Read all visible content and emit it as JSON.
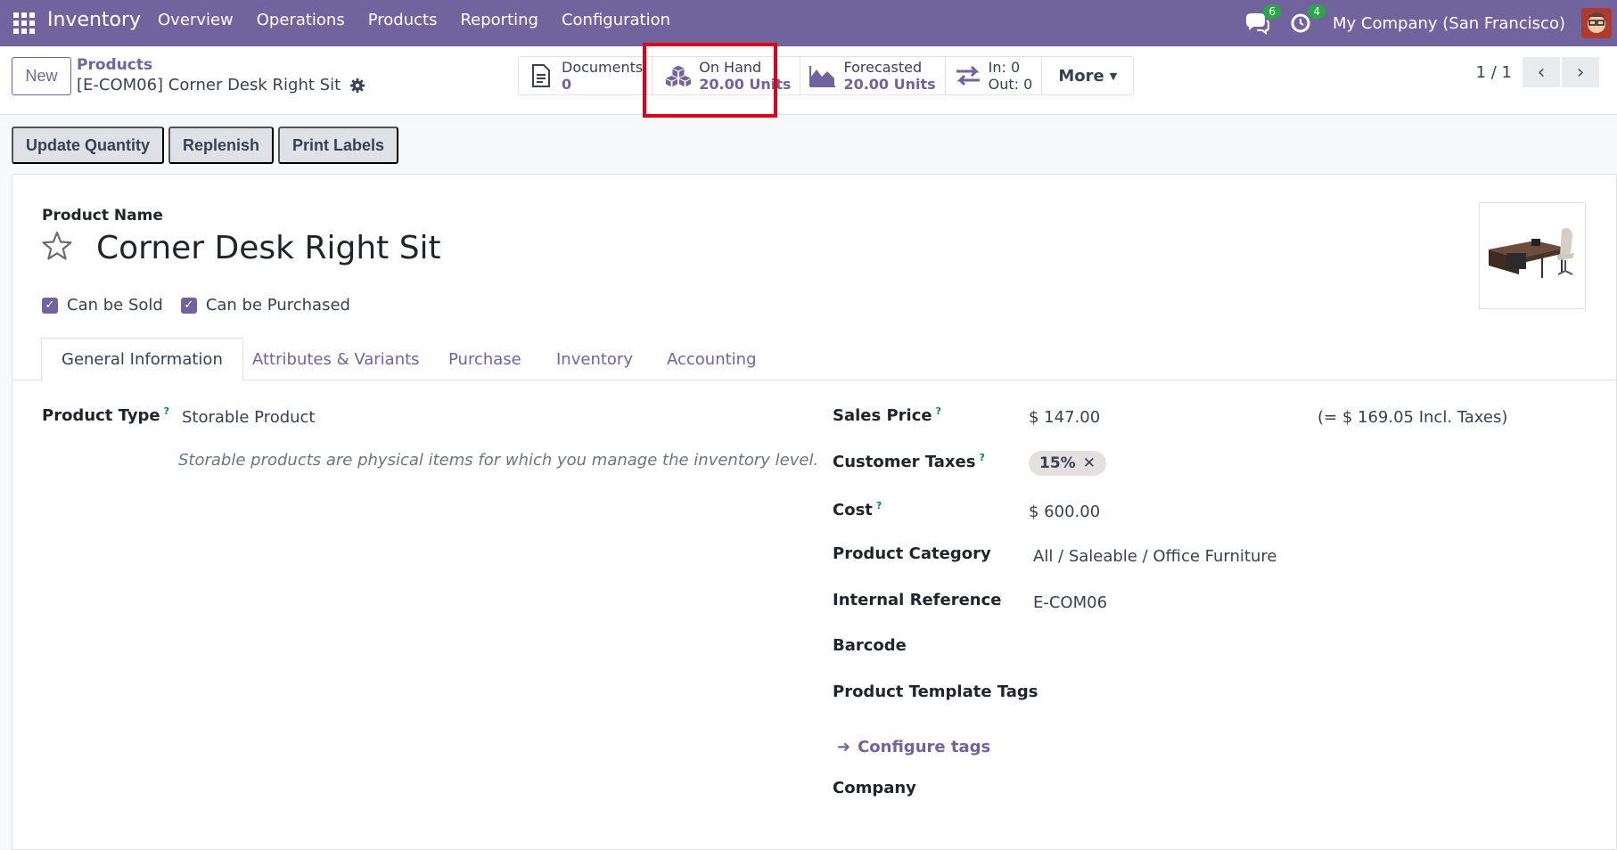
{
  "navbar": {
    "app_name": "Inventory",
    "menu": [
      "Overview",
      "Operations",
      "Products",
      "Reporting",
      "Configuration"
    ],
    "messages_count": "6",
    "activities_count": "4",
    "company": "My Company (San Francisco)"
  },
  "control_panel": {
    "new_label": "New",
    "breadcrumb_parent": "Products",
    "breadcrumb_current": "[E-COM06] Corner Desk Right Sit",
    "stats": {
      "documents_label": "Documents",
      "documents_value": "0",
      "on_hand_label": "On Hand",
      "on_hand_value": "20.00 Units",
      "forecasted_label": "Forecasted",
      "forecasted_value": "20.00 Units",
      "in_label": "In: 0",
      "out_label": "Out: 0",
      "more_label": "More"
    },
    "pager": "1 / 1"
  },
  "actions": [
    "Update Quantity",
    "Replenish",
    "Print Labels"
  ],
  "form": {
    "product_name_label": "Product Name",
    "product_name": "Corner Desk Right Sit",
    "can_be_sold": "Can be Sold",
    "can_be_purchased": "Can be Purchased",
    "tabs": [
      "General Information",
      "Attributes & Variants",
      "Purchase",
      "Inventory",
      "Accounting"
    ],
    "product_type_label": "Product Type",
    "product_type": "Storable Product",
    "product_type_help": "Storable products are physical items for which you manage the inventory level.",
    "sales_price_label": "Sales Price",
    "sales_price": "$ 147.00",
    "sales_price_incl": "(= $ 169.05 Incl. Taxes)",
    "customer_taxes_label": "Customer Taxes",
    "customer_tax": "15%",
    "cost_label": "Cost",
    "cost": "$ 600.00",
    "category_label": "Product Category",
    "category": "All / Saleable / Office Furniture",
    "internal_ref_label": "Internal Reference",
    "internal_ref": "E-COM06",
    "barcode_label": "Barcode",
    "template_tags_label": "Product Template Tags",
    "configure_tags": "Configure tags",
    "company_label": "Company",
    "help_mark": "?"
  },
  "colors": {
    "brand": "#71639e",
    "highlight": "#e0001a",
    "badge": "#28a745"
  }
}
